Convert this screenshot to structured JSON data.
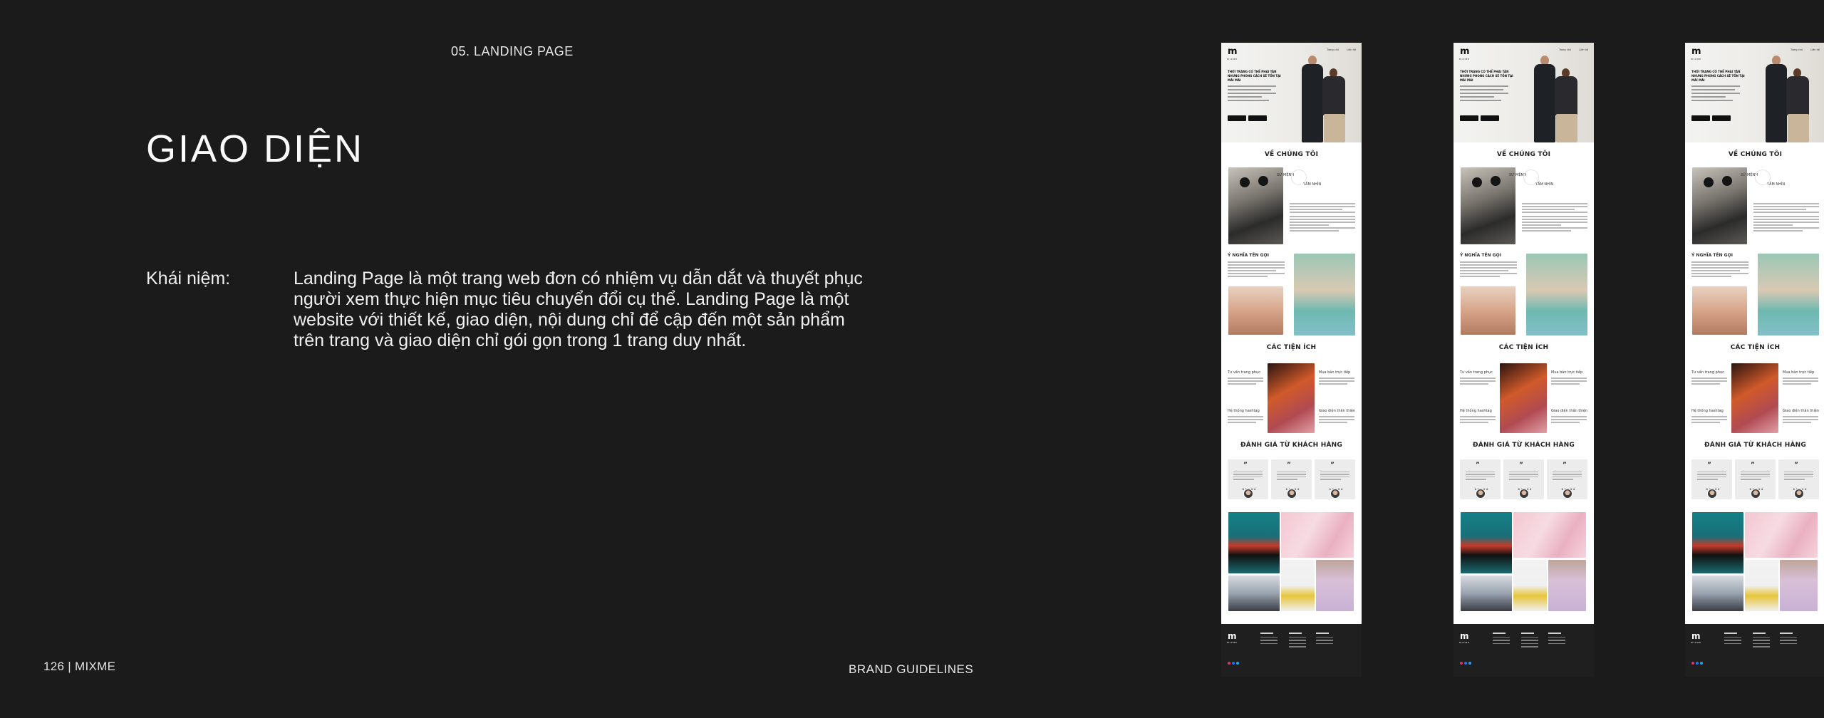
{
  "section_label": "05. LANDING PAGE",
  "title": "GIAO DIỆN",
  "concept": {
    "label": "Khái niệm:",
    "text": "Landing Page là một trang web đơn có nhiệm vụ dẫn dắt và thuyết phục người xem thực hiện mục tiêu chuyển đổi cụ thể. Landing Page là một website với thiết kế, giao diện, nội dung chỉ để cập đến một sản phẩm trên trang và giao diện chỉ gói gọn trong 1 trang duy nhất."
  },
  "page_number": "126 | MIXME",
  "footer_center": "BRAND GUIDELINES",
  "mockup": {
    "logo": "m",
    "brand": "MIXME",
    "nav": [
      "Trang chủ",
      "Liên hệ"
    ],
    "hero_copy": "THỜI TRANG CÓ THỂ PHAI TÀN NHƯNG PHONG CÁCH SẼ TỒN TẠI MÃI MÃI",
    "headings": {
      "about": "VỀ CHÚNG TÔI",
      "mission": "SỨ MỆNH",
      "vision": "TẦM NHÌN",
      "name_meaning": "Ý NGHĨA TÊN GỌI",
      "features": "CÁC TIỆN ÍCH",
      "reviews": "ĐÁNH GIÁ TỪ KHÁCH HÀNG"
    },
    "features": [
      "Tư vấn trang phục",
      "Mua bán trực tiếp",
      "Hệ thống hashtag",
      "Giao diện thân thiện"
    ],
    "quote_mark": "”",
    "stars": "★★★★★"
  },
  "colors": {
    "background": "#1b1b1b",
    "text": "#f2f2f2",
    "mockup_footer": "#1f1f1f"
  }
}
